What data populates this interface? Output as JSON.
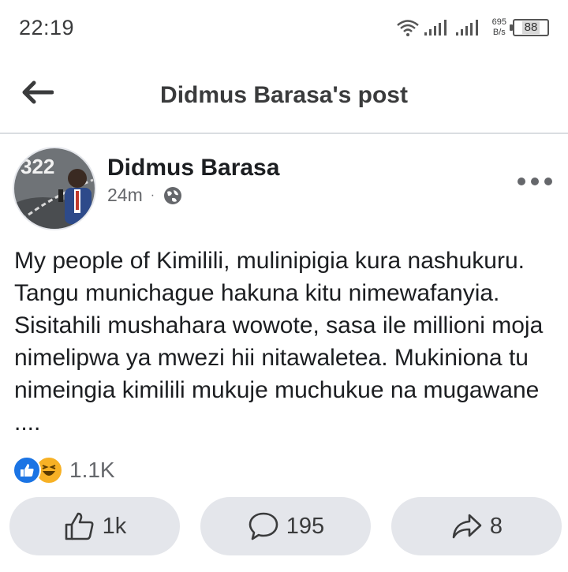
{
  "status_bar": {
    "time": "22:19",
    "net_speed_value": "695",
    "net_speed_unit": "B/s",
    "battery": "88"
  },
  "header": {
    "title": "Didmus Barasa's post"
  },
  "post": {
    "author": "Didmus Barasa",
    "time_ago": "24m",
    "meta_separator": "·",
    "privacy_icon": "globe-icon",
    "avatar_text": "322",
    "text": "My people of Kimilili, mulinipigia kura nashukuru. Tangu munichague hakuna kitu nimewafanyia. Sisitahili mushahara wowote, sasa ile millioni moja nimelipwa ya mwezi hii nitawaletea. Mukiniona tu nimeingia kimilili mukuje muchukue na mugawane ...."
  },
  "reactions": {
    "count": "1.1K",
    "types": [
      "like-reaction-icon",
      "haha-reaction-icon"
    ]
  },
  "actions": {
    "like_count": "1k",
    "comment_count": "195",
    "share_count": "8"
  },
  "colors": {
    "accent": "#1b74e4",
    "button_bg": "#e4e6eb",
    "secondary_text": "#65676b"
  }
}
